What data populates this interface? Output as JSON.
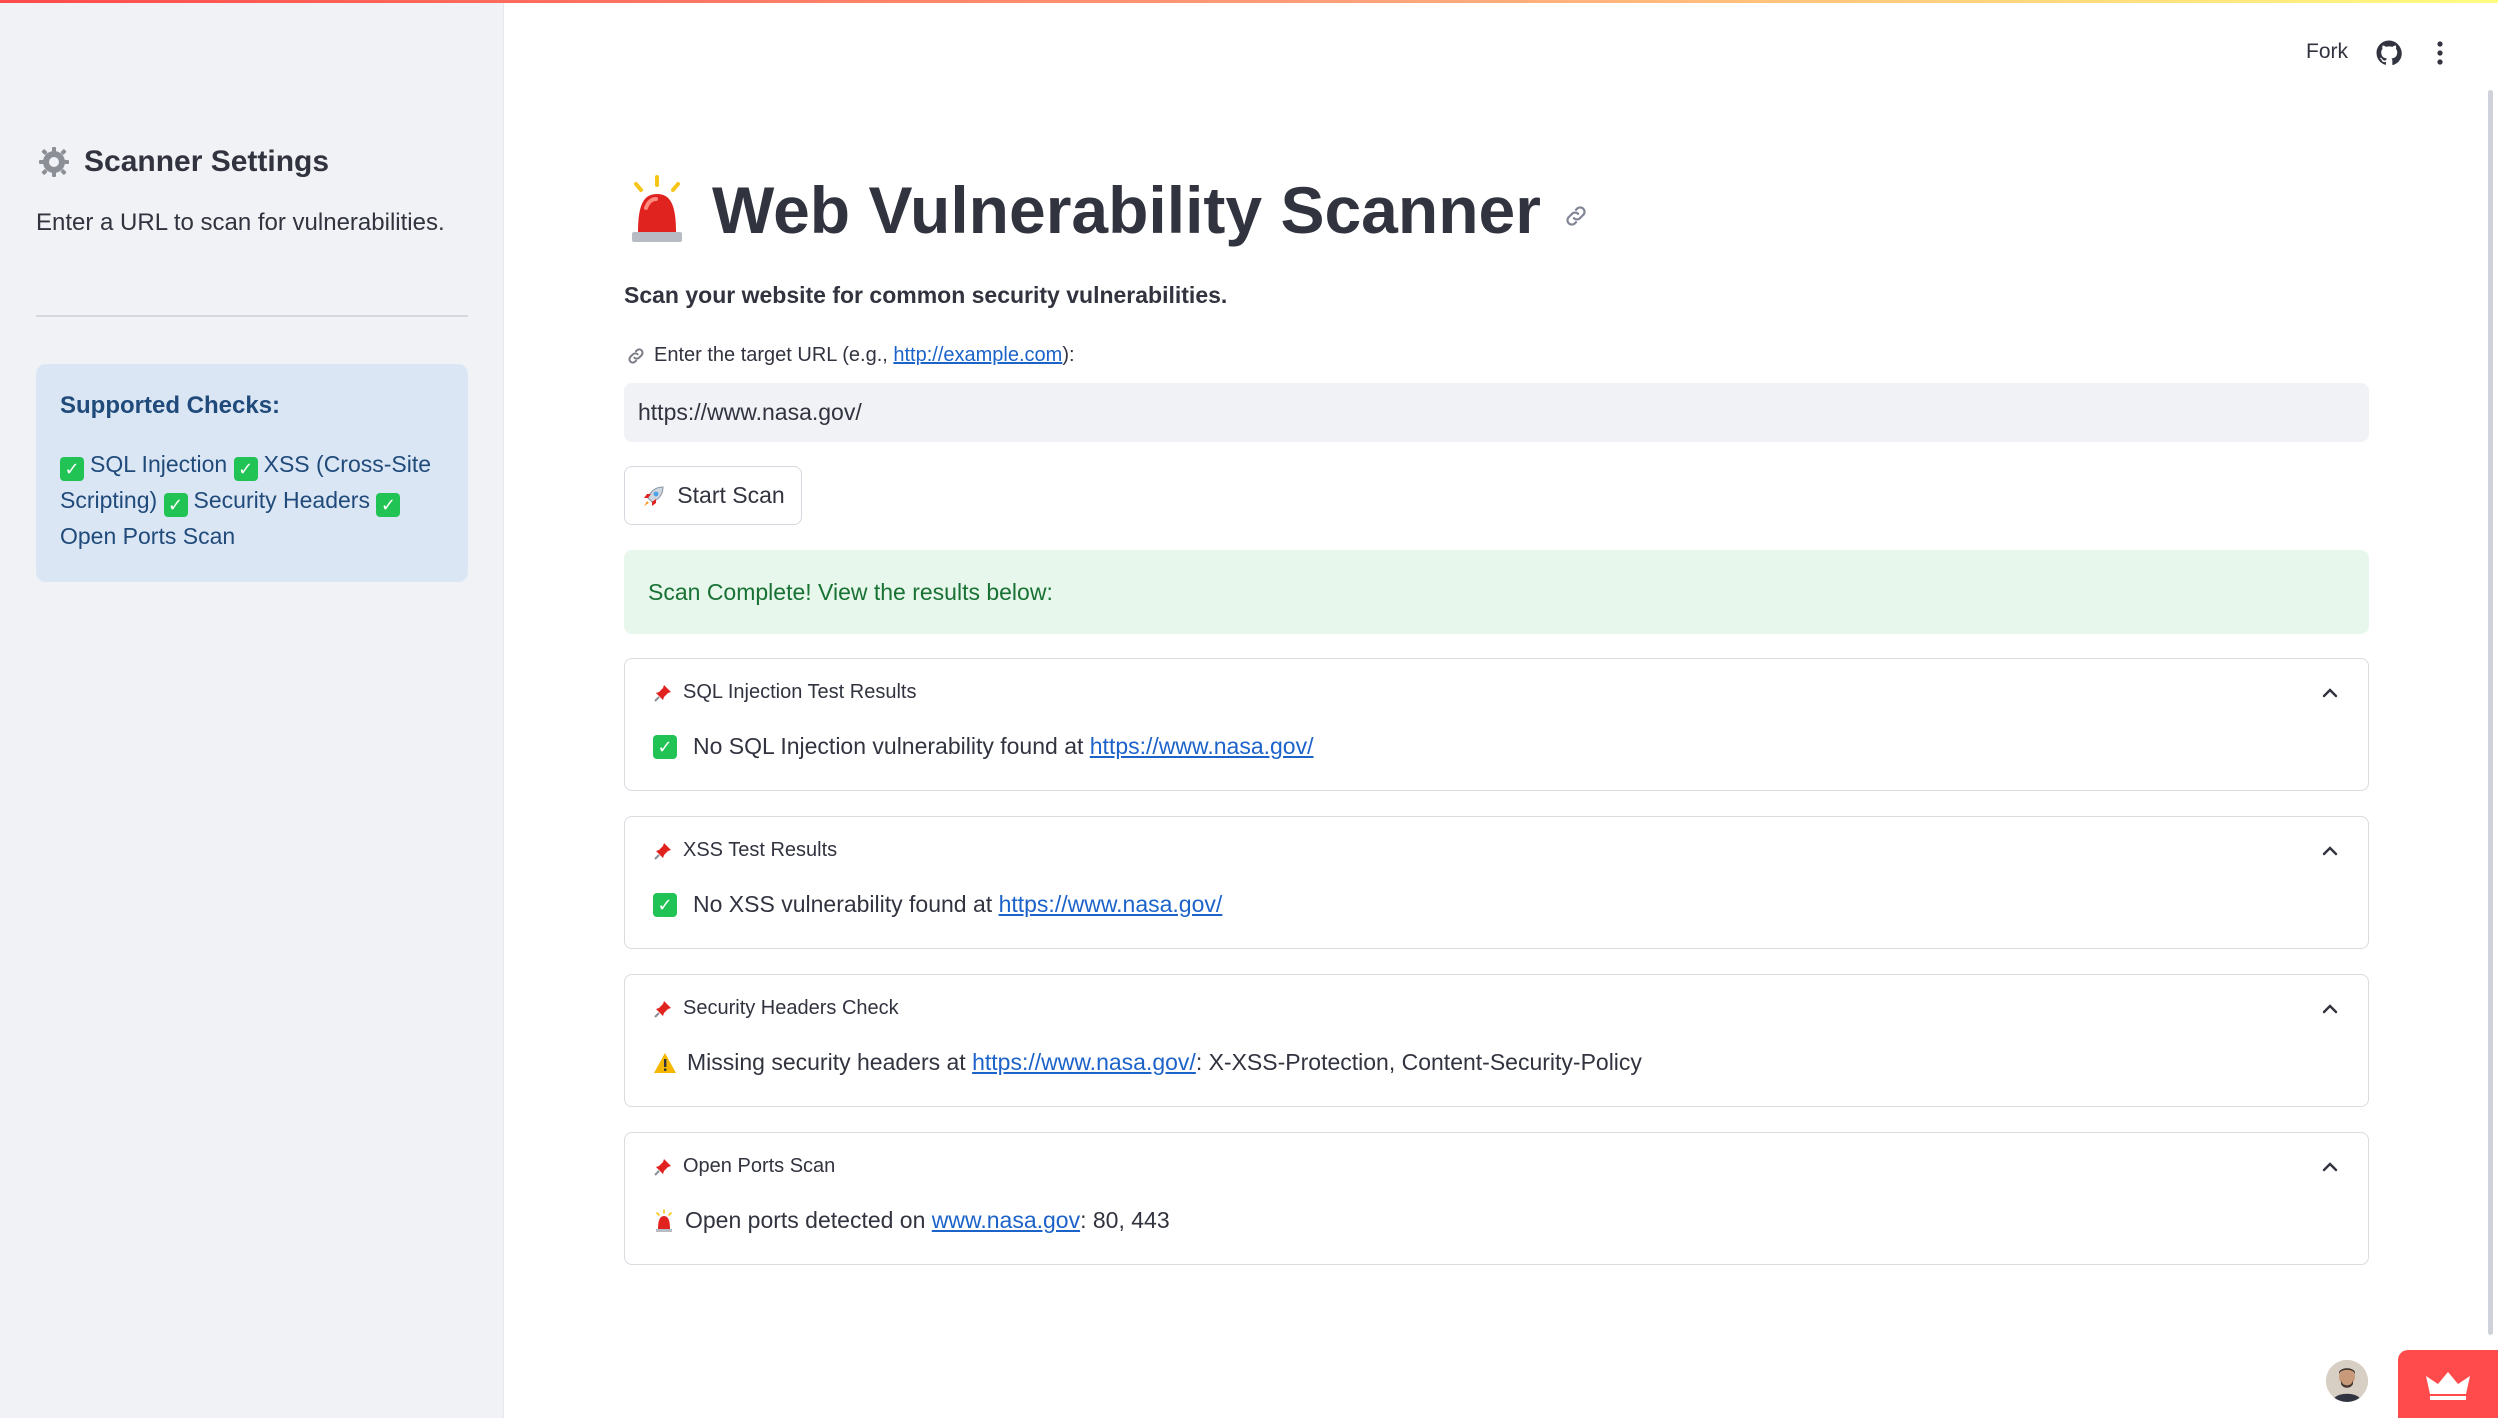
{
  "header": {
    "fork_label": "Fork",
    "github_icon": "github-icon",
    "menu_icon": "kebab-menu-icon"
  },
  "sidebar": {
    "title": "Scanner Settings",
    "title_icon": "gear-icon",
    "description": "Enter a URL to scan for vulnerabilities.",
    "supported_title": "Supported Checks:",
    "checks": [
      "SQL Injection",
      "XSS (Cross-Site Scripting)",
      "Security Headers",
      "Open Ports Scan"
    ]
  },
  "main": {
    "title": "Web Vulnerability Scanner",
    "title_icon": "siren-icon",
    "subtitle": "Scan your website for common security vulnerabilities.",
    "input_label_prefix": "Enter the target URL (e.g., ",
    "input_label_link": "http://example.com",
    "input_label_suffix": "):",
    "url_value": "https://www.nasa.gov/",
    "start_button": "Start Scan",
    "success_message": "Scan Complete! View the results below:",
    "results": [
      {
        "title": "SQL Injection Test Results",
        "icon": "check-icon",
        "text": "No SQL Injection vulnerability found at ",
        "link": "https://www.nasa.gov/",
        "suffix": ""
      },
      {
        "title": "XSS Test Results",
        "icon": "check-icon",
        "text": "No XSS vulnerability found at ",
        "link": "https://www.nasa.gov/",
        "suffix": ""
      },
      {
        "title": "Security Headers Check",
        "icon": "warning-icon",
        "text": "Missing security headers at ",
        "link": "https://www.nasa.gov/",
        "suffix": ": X-XSS-Protection, Content-Security-Policy"
      },
      {
        "title": "Open Ports Scan",
        "icon": "siren-icon",
        "text": "Open ports detected on ",
        "link": "www.nasa.gov",
        "suffix": ": 80, 443"
      }
    ]
  },
  "colors": {
    "accent": "#ff4b4b",
    "success_bg": "#e8f7ec",
    "success_text": "#177233",
    "info_bg": "#dbe6f4",
    "link": "#1c63c9"
  }
}
